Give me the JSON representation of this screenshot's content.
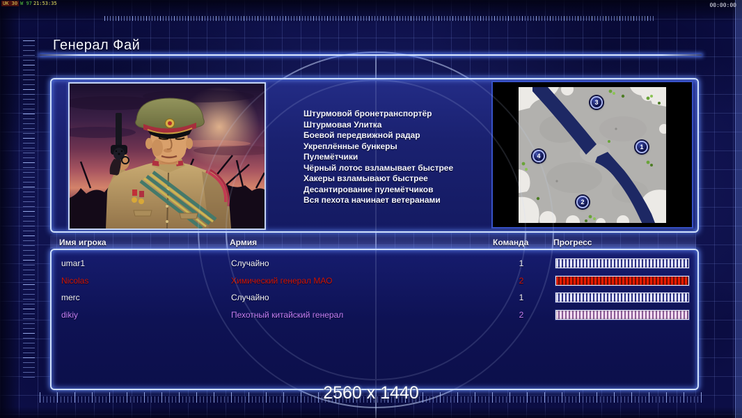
{
  "hud": {
    "recording_overlay": {
      "segment1": "UK 30",
      "segment2": "W 97",
      "time": "21:53:35"
    },
    "timer": "00:00:00"
  },
  "header": {
    "title": "Генерал Фай"
  },
  "briefing": {
    "abilities": [
      "Штурмовой бронетранспортёр",
      "Штурмовая Улитка",
      "Боевой передвижной радар",
      "Укреплённые бункеры",
      "Пулемётчики",
      "Чёрный лотос взламывает быстрее",
      "Хакеры взламывают быстрее",
      "Десантирование пулемётчиков",
      "Вся пехота начинает ветеранами"
    ]
  },
  "minimap": {
    "markers": [
      {
        "label": "3"
      },
      {
        "label": "1"
      },
      {
        "label": "4"
      },
      {
        "label": "2"
      }
    ]
  },
  "players": {
    "columns": {
      "name": "Имя игрока",
      "army": "Армия",
      "team": "Команда",
      "progress": "Прогресс"
    },
    "rows": [
      {
        "name": "umar1",
        "army": "Случайно",
        "team": "1",
        "progress_pct": 100,
        "color": "#f4f4f4",
        "bar_color": "#e4e6ff",
        "bar_gap": "#2a2e80"
      },
      {
        "name": "Nicolas",
        "army": "Химический генерал МАО",
        "team": "2",
        "progress_pct": 100,
        "color": "#d01404",
        "bar_color": "#e81c00",
        "bar_gap": "#6e0c00"
      },
      {
        "name": "merc",
        "army": "Случайно",
        "team": "1",
        "progress_pct": 100,
        "color": "#f4f4f4",
        "bar_color": "#e4e6ff",
        "bar_gap": "#2a2e80"
      },
      {
        "name": "dikiy",
        "army": "Пехотный китайский генерал",
        "team": "2",
        "progress_pct": 100,
        "color": "#c47ef2",
        "bar_color": "#f4dcf0",
        "bar_gap": "#8a5a96"
      }
    ]
  },
  "footer": {
    "resolution": "2560 x 1440"
  },
  "theme": {
    "panel_border": "#cfe0fb",
    "background": "#0c0e46",
    "grid_line": "#8296eb"
  }
}
